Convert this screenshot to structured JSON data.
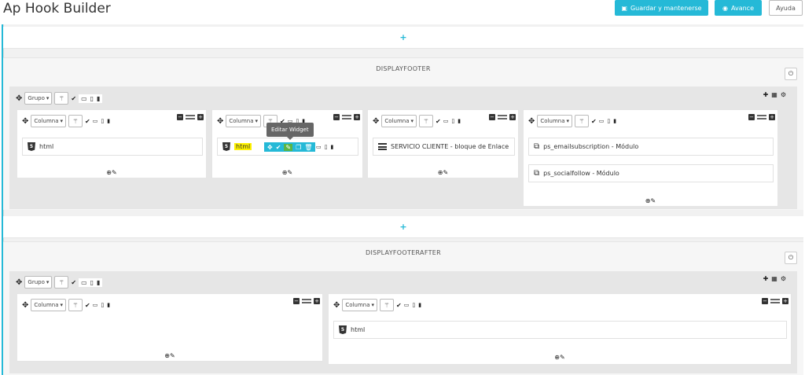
{
  "header": {
    "title": "Ap Hook Builder",
    "save_label": "Guardar y mantenerse",
    "advanced_label": "Avance",
    "help_label": "Ayuda"
  },
  "add_symbol": "+",
  "hooks": [
    {
      "title": "DISPLAYFOOTER",
      "group_select": "Grupo",
      "columns": [
        {
          "select": "Columna",
          "widgets": [
            {
              "type": "html",
              "label": "html"
            }
          ]
        },
        {
          "select": "Columna",
          "widgets": [
            {
              "type": "html",
              "label": "html",
              "highlighted": true
            }
          ]
        },
        {
          "select": "Columna",
          "widgets": [
            {
              "type": "links",
              "label": "SERVICIO CLIENTE - bloque de Enlace"
            }
          ]
        },
        {
          "select": "Columna",
          "widgets": [
            {
              "type": "module",
              "label": "ps_emailsubscription - Módulo"
            },
            {
              "type": "module",
              "label": "ps_socialfollow - Módulo"
            }
          ]
        }
      ]
    },
    {
      "title": "DISPLAYFOOTERAFTER",
      "group_select": "Grupo",
      "columns": [
        {
          "select": "Columna",
          "widgets": []
        },
        {
          "select": "Columna",
          "widgets": [
            {
              "type": "html",
              "label": "html"
            }
          ]
        }
      ]
    }
  ],
  "tooltip": "Editar Widget",
  "icons": {
    "move": "move-icon",
    "wand": "magic-wand-icon",
    "check": "check-icon",
    "devices": [
      "desktop-icon",
      "tablet-icon",
      "phone-icon"
    ],
    "power": "power-icon",
    "html5": "html5-icon",
    "module": "module-icon",
    "links": "list-icon"
  },
  "colors": {
    "accent": "#25b9d7",
    "highlight": "#fff200",
    "edit_green": "#5ab545"
  }
}
